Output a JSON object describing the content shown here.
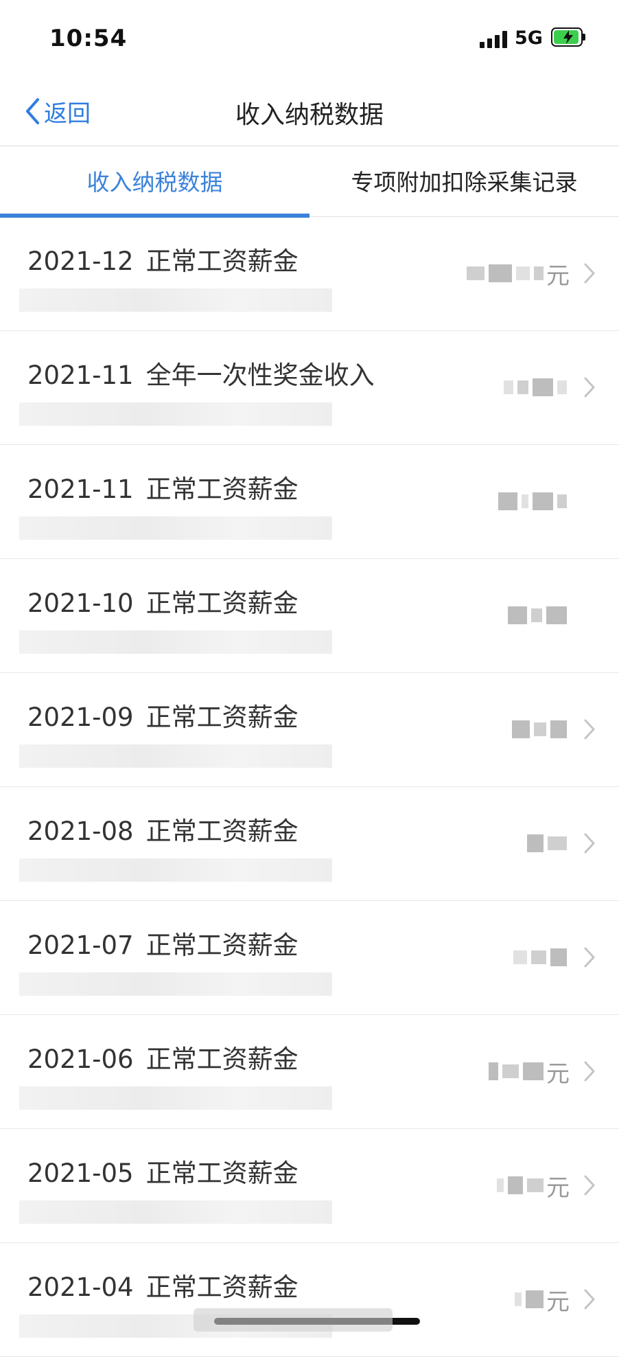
{
  "status_bar": {
    "time": "10:54",
    "network": "5G",
    "icons": {
      "signal": "signal-bars-icon",
      "battery": "battery-charging-icon"
    },
    "battery_color": "#3ccf4e"
  },
  "nav": {
    "back_label": "返回",
    "back_icon": "chevron-left-icon",
    "title": "收入纳税数据",
    "accent_color": "#2f7de1"
  },
  "tabs": [
    {
      "label": "收入纳税数据",
      "active": true
    },
    {
      "label": "专项附加扣除采集记录",
      "active": false
    }
  ],
  "records": [
    {
      "period": "2021-12",
      "type": "正常工资薪金",
      "amount_unit": "元"
    },
    {
      "period": "2021-11",
      "type": "全年一次性奖金收入",
      "amount_unit": ""
    },
    {
      "period": "2021-11",
      "type": "正常工资薪金",
      "amount_unit": ""
    },
    {
      "period": "2021-10",
      "type": "正常工资薪金",
      "amount_unit": ""
    },
    {
      "period": "2021-09",
      "type": "正常工资薪金",
      "amount_unit": ""
    },
    {
      "period": "2021-08",
      "type": "正常工资薪金",
      "amount_unit": ""
    },
    {
      "period": "2021-07",
      "type": "正常工资薪金",
      "amount_unit": ""
    },
    {
      "period": "2021-06",
      "type": "正常工资薪金",
      "amount_unit": "元"
    },
    {
      "period": "2021-05",
      "type": "正常工资薪金",
      "amount_unit": "元"
    },
    {
      "period": "2021-04",
      "type": "正常工资薪金",
      "amount_unit": "元"
    }
  ]
}
